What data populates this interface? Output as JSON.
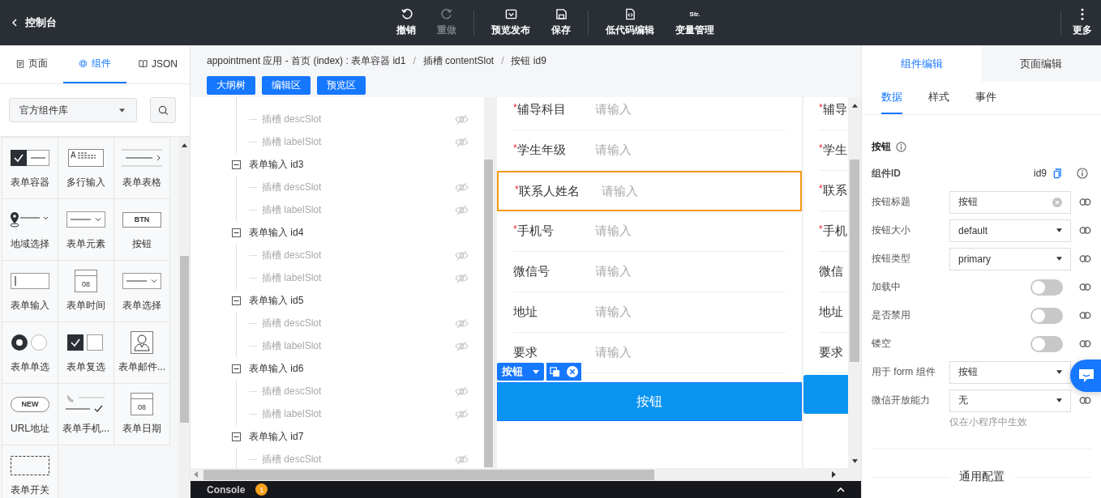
{
  "topbar": {
    "back_label": "控制台",
    "groups": [
      [
        {
          "label": "撤销",
          "kind": "undo",
          "disabled": false
        },
        {
          "label": "重做",
          "kind": "redo",
          "disabled": true
        }
      ],
      [
        {
          "label": "预览发布",
          "kind": "preview",
          "disabled": false
        },
        {
          "label": "保存",
          "kind": "save",
          "disabled": false
        }
      ],
      [
        {
          "label": "低代码编辑",
          "kind": "code",
          "disabled": false
        },
        {
          "label": "变量管理",
          "kind": "text",
          "icon_text": "Str.",
          "disabled": false
        }
      ]
    ],
    "more_label": "更多"
  },
  "left_panel": {
    "tabs": [
      {
        "label": "页面",
        "kind": "page",
        "selected": false
      },
      {
        "label": "组件",
        "kind": "component",
        "selected": true
      },
      {
        "label": "JSON",
        "kind": "book",
        "selected": false
      }
    ],
    "library_select": {
      "value": "官方组件库"
    },
    "components": [
      {
        "label": "表单容器",
        "kind": "container"
      },
      {
        "label": "多行输入",
        "kind": "textarea",
        "icon_text": "A"
      },
      {
        "label": "表单表格",
        "kind": "table"
      },
      {
        "label": "地域选择",
        "kind": "region"
      },
      {
        "label": "表单元素",
        "kind": "dropdown"
      },
      {
        "label": "按钮",
        "kind": "button",
        "icon_text": "BTN"
      },
      {
        "label": "表单输入",
        "kind": "input"
      },
      {
        "label": "表单时间",
        "kind": "calendar",
        "icon_text": "08"
      },
      {
        "label": "表单选择",
        "kind": "dropdown"
      },
      {
        "label": "表单单选",
        "kind": "radio"
      },
      {
        "label": "表单复选",
        "kind": "checkbox"
      },
      {
        "label": "表单邮件...",
        "kind": "person"
      },
      {
        "label": "URL地址",
        "kind": "pill",
        "icon_text": "NEW"
      },
      {
        "label": "表单手机...",
        "kind": "phone"
      },
      {
        "label": "表单日期",
        "kind": "calendar",
        "icon_text": "08"
      },
      {
        "label": "表单开关",
        "kind": "dashed"
      }
    ]
  },
  "editor": {
    "breadcrumb": [
      {
        "text": "appointment 应用 - 首页 (index) : 表单容器 id1"
      },
      {
        "separator": "/",
        "text": "插槽 contentSlot"
      },
      {
        "separator": "/",
        "text": "按钮 id9"
      }
    ],
    "required_mark": "*",
    "view_buttons": [
      "大纲树",
      "编辑区",
      "预览区"
    ],
    "tree": [
      {
        "expanded": true,
        "children": [
          {
            "label": "插槽 descSlot",
            "hidden": true
          },
          {
            "label": "插槽 labelSlot",
            "hidden": true
          }
        ]
      },
      {
        "label": "表单输入 id3",
        "expanded": true,
        "children": [
          {
            "label": "插槽 descSlot",
            "hidden": true
          },
          {
            "label": "插槽 labelSlot",
            "hidden": true
          }
        ]
      },
      {
        "label": "表单输入 id4",
        "expanded": true,
        "children": [
          {
            "label": "插槽 descSlot",
            "hidden": true
          },
          {
            "label": "插槽 labelSlot",
            "hidden": true
          }
        ]
      },
      {
        "label": "表单输入 id5",
        "expanded": true,
        "children": [
          {
            "label": "插槽 descSlot",
            "hidden": true
          },
          {
            "label": "插槽 labelSlot",
            "hidden": true
          }
        ]
      },
      {
        "label": "表单输入 id6",
        "expanded": true,
        "children": [
          {
            "label": "插槽 descSlot",
            "hidden": true
          },
          {
            "label": "插槽 labelSlot",
            "hidden": true
          }
        ]
      },
      {
        "label": "表单输入 id7",
        "expanded": true,
        "children": [
          {
            "label": "插槽 descSlot",
            "hidden": true
          }
        ]
      }
    ],
    "form_rows": [
      {
        "label": "辅导科目",
        "required": true,
        "placeholder": "请输入",
        "selected": false
      },
      {
        "label": "学生年级",
        "required": true,
        "placeholder": "请输入",
        "selected": false
      },
      {
        "label": "联系人姓名",
        "required": true,
        "placeholder": "请输入",
        "selected": true
      },
      {
        "label": "手机号",
        "required": true,
        "placeholder": "请输入",
        "selected": false
      },
      {
        "label": "微信号",
        "required": false,
        "placeholder": "请输入",
        "selected": false
      },
      {
        "label": "地址",
        "required": false,
        "placeholder": "请输入",
        "selected": false
      },
      {
        "label": "要求",
        "required": false,
        "placeholder": "请输入",
        "selected": false
      }
    ],
    "selection_tag": "按钮",
    "form_button": "按钮",
    "mirror_rows": [
      {
        "label": "辅导",
        "required": true
      },
      {
        "label": "学生",
        "required": true
      },
      {
        "label": "联系",
        "required": true
      },
      {
        "label": "手机",
        "required": true
      },
      {
        "label": "微信",
        "required": false
      },
      {
        "label": "地址",
        "required": false
      },
      {
        "label": "要求",
        "required": false
      }
    ],
    "console": {
      "label": "Console",
      "badge": "1"
    }
  },
  "right_panel": {
    "tabs": [
      {
        "label": "组件编辑",
        "selected": true
      },
      {
        "label": "页面编辑",
        "selected": false
      }
    ],
    "subtabs": [
      {
        "label": "数据",
        "selected": true
      },
      {
        "label": "样式",
        "selected": false
      },
      {
        "label": "事件",
        "selected": false
      }
    ],
    "section_title": "按钮",
    "component_id": {
      "label": "组件ID",
      "value": "id9"
    },
    "props": [
      {
        "kind": "input",
        "label": "按钮标题",
        "value": "按钮",
        "link": true
      },
      {
        "kind": "select",
        "label": "按钮大小",
        "value": "default",
        "link": true
      },
      {
        "kind": "select",
        "label": "按钮类型",
        "value": "primary",
        "link": true
      },
      {
        "kind": "switch",
        "label": "加载中",
        "on": false,
        "link": true
      },
      {
        "kind": "switch",
        "label": "是否禁用",
        "on": false,
        "link": true
      },
      {
        "kind": "switch",
        "label": "镂空",
        "on": false,
        "link": true
      },
      {
        "kind": "select",
        "label": "用于 form 组件",
        "value": "按钮",
        "link": false
      },
      {
        "kind": "select",
        "label": "微信开放能力",
        "value": "无",
        "link": true,
        "hint": "仅在小程序中生效"
      }
    ],
    "general_section": "通用配置"
  }
}
